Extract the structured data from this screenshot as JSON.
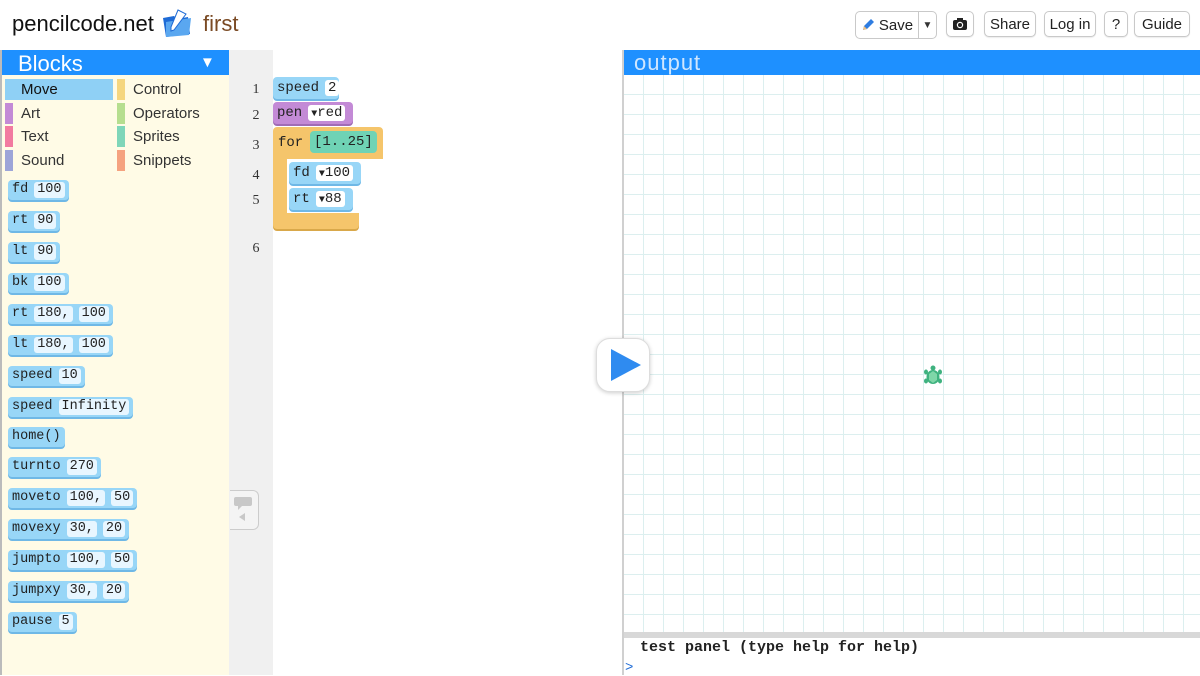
{
  "header": {
    "site": "pencilcode.net",
    "filename": "first",
    "buttons": {
      "save": "Save",
      "share": "Share",
      "login": "Log in",
      "help": "?",
      "guide": "Guide"
    },
    "icons": {
      "folder": "folder-icon",
      "pencil": "pencil-icon",
      "camera": "camera-icon",
      "caret": "caret-down-icon"
    }
  },
  "palette": {
    "title": "Blocks",
    "categories": [
      {
        "label": "Move",
        "color": "#8fd0f5",
        "selected": true
      },
      {
        "label": "Control",
        "color": "#f5d67f"
      },
      {
        "label": "Art",
        "color": "#c38ad6"
      },
      {
        "label": "Operators",
        "color": "#b6de8f"
      },
      {
        "label": "Text",
        "color": "#f27aa0"
      },
      {
        "label": "Sprites",
        "color": "#7fd6b9"
      },
      {
        "label": "Sound",
        "color": "#9da5d8"
      },
      {
        "label": "Snippets",
        "color": "#f5a27f"
      }
    ],
    "blocks": [
      {
        "cmd": "fd",
        "args": [
          "100"
        ]
      },
      {
        "cmd": "rt",
        "args": [
          "90"
        ]
      },
      {
        "cmd": "lt",
        "args": [
          "90"
        ]
      },
      {
        "cmd": "bk",
        "args": [
          "100"
        ]
      },
      {
        "cmd": "rt",
        "args": [
          "180,",
          "100"
        ]
      },
      {
        "cmd": "lt",
        "args": [
          "180,",
          "100"
        ]
      },
      {
        "cmd": "speed",
        "args": [
          "10"
        ]
      },
      {
        "cmd": "speed",
        "args": [
          "Infinity"
        ]
      },
      {
        "cmd": "home()",
        "args": []
      },
      {
        "cmd": "turnto",
        "args": [
          "270"
        ]
      },
      {
        "cmd": "moveto",
        "args": [
          "100,",
          "50"
        ]
      },
      {
        "cmd": "movexy",
        "args": [
          "30,",
          "20"
        ]
      },
      {
        "cmd": "jumpto",
        "args": [
          "100,",
          "50"
        ]
      },
      {
        "cmd": "jumpxy",
        "args": [
          "30,",
          "20"
        ]
      },
      {
        "cmd": "pause",
        "args": [
          "5"
        ]
      }
    ]
  },
  "editor": {
    "line_numbers": [
      "1",
      "2",
      "3",
      "4",
      "5",
      "6"
    ],
    "code": {
      "speed": {
        "cmd": "speed",
        "arg": "2"
      },
      "pen": {
        "cmd": "pen",
        "arg": "red"
      },
      "for": {
        "cmd": "for",
        "range": "[1..25]"
      },
      "fd": {
        "cmd": "fd",
        "arg": "100"
      },
      "rt": {
        "cmd": "rt",
        "arg": "88"
      }
    }
  },
  "output": {
    "title": "output",
    "test_panel": "test panel (type help for help)",
    "prompt": ">"
  },
  "colors": {
    "accent": "#1e90ff",
    "move_block": "#98d6f7",
    "art_block": "#c38ad6",
    "control_block": "#f5c56b",
    "operator_block": "#6fd3b5"
  }
}
